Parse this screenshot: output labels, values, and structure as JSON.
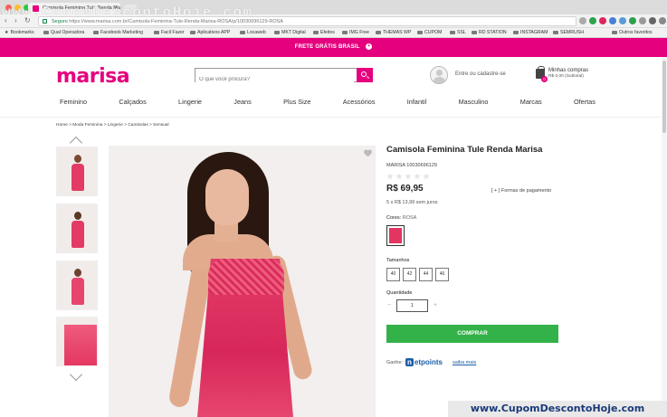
{
  "browser": {
    "tab_title": "Camisola Feminina Tule Renda Ma",
    "tab_close": "×",
    "watermark_top": "www.CupomDescontoHoje.com",
    "url_secure": "Seguro",
    "url": "https://www.marisa.com.br/Camisola-Feminina-Tule-Renda-Marisa-ROSA/p/10030696129-ROSA",
    "bookmarks": [
      "Bookmarks",
      "Qual Operadora",
      "Facebook Marketing",
      "Facil Fazer",
      "Aplicativos APP",
      "Locaweb",
      "MKT Digital",
      "Efeitos",
      "IMG Free",
      "THEMAS WP",
      "CUPOM",
      "SSL",
      "RD STATION",
      "INSTAGRAM",
      "SEMRUSH",
      "Outros favoritos"
    ]
  },
  "promo": {
    "text": "FRETE GRÁTIS BRASIL",
    "icon": "+"
  },
  "header": {
    "logo": "marisa",
    "search_placeholder": "O que você procura?",
    "login": "Entre ou cadastre-se",
    "cart_title": "Minhas compras",
    "cart_subtotal": "R$ 0,00 (Subtotal)",
    "cart_count": "0"
  },
  "menu": [
    "Feminino",
    "Calçados",
    "Lingerie",
    "Jeans",
    "Plus Size",
    "Acessórios",
    "Infantil",
    "Masculino",
    "Marcas",
    "Ofertas"
  ],
  "breadcrumb": "Home > Moda Feminina > Lingerie > Camisolas > Sensual",
  "product": {
    "title": "Camisola Feminina Tule Renda Marisa",
    "sku": "MARISA 10030696129",
    "price": "R$ 69,95",
    "payment_forms": "[ + ] Formas de pagamento",
    "installments": "5 x R$ 13,99 sem juros",
    "colors_label": "Cores:",
    "color_value": "ROSA",
    "swatch_color": "#e23561",
    "sizes_label": "Tamanhos",
    "sizes": [
      "40",
      "42",
      "44",
      "46"
    ],
    "qty_label": "Quantidade",
    "qty_minus": "−",
    "qty_value": "1",
    "qty_plus": "+",
    "buy_label": "COMPRAR",
    "earn_label": "Ganhe:",
    "netpoints_n": "n",
    "netpoints_rest": "etpoints",
    "saiba_mais": "saiba mais"
  },
  "watermark_bottom": "www.CupomDescontoHoje.com",
  "colors": {
    "brand": "#e5007e",
    "buy": "#33b249",
    "netpoints": "#1b5ea8"
  }
}
